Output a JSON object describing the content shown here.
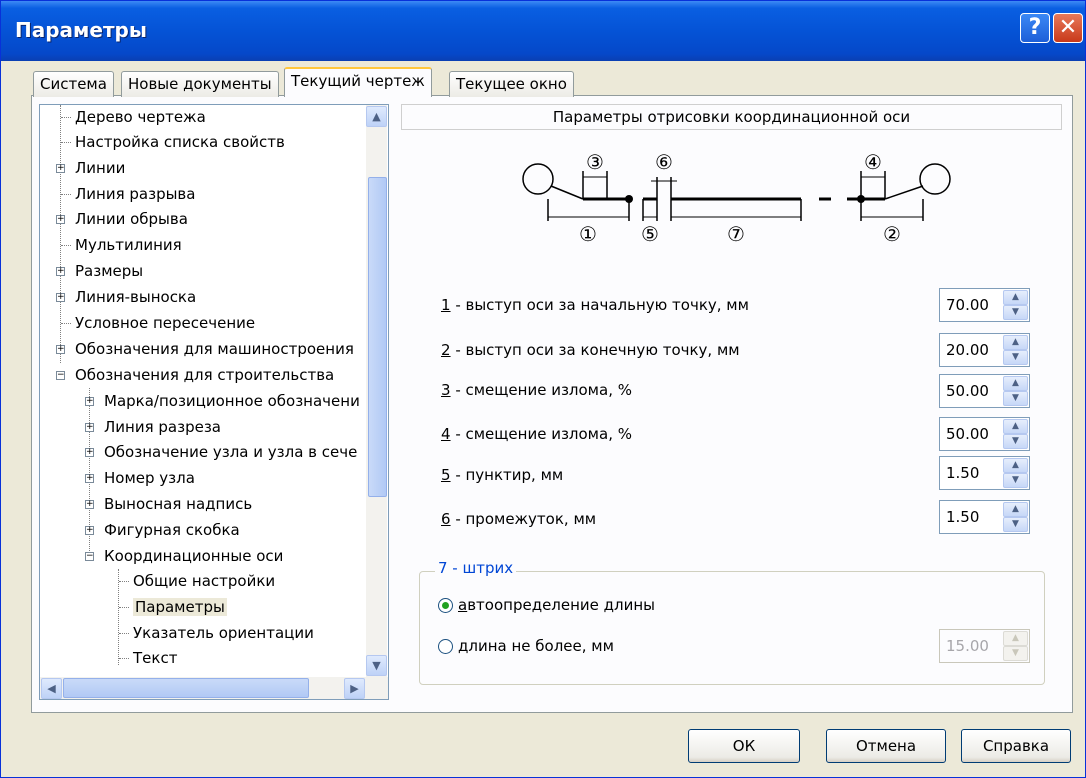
{
  "window": {
    "title": "Параметры"
  },
  "tabs": [
    {
      "label": "Система"
    },
    {
      "label": "Новые документы"
    },
    {
      "label": "Текущий чертеж"
    },
    {
      "label": "Текущее окно"
    }
  ],
  "tree": {
    "items": [
      {
        "label": "Дерево чертежа"
      },
      {
        "label": "Настройка списка свойств"
      },
      {
        "label": "Линии"
      },
      {
        "label": "Линия разрыва"
      },
      {
        "label": "Линии обрыва"
      },
      {
        "label": "Мультилиния"
      },
      {
        "label": "Размеры"
      },
      {
        "label": "Линия-выноска"
      },
      {
        "label": "Условное пересечение"
      },
      {
        "label": "Обозначения для машиностроения"
      },
      {
        "label": "Обозначения для строительства"
      },
      {
        "label": "Марка/позиционное обозначени"
      },
      {
        "label": "Линия разреза"
      },
      {
        "label": "Обозначение узла и узла в сече"
      },
      {
        "label": "Номер узла"
      },
      {
        "label": "Выносная надпись"
      },
      {
        "label": "Фигурная скобка"
      },
      {
        "label": "Координационные оси"
      },
      {
        "label": "Общие настройки"
      },
      {
        "label": "Параметры"
      },
      {
        "label": "Указатель ориентации"
      },
      {
        "label": "Текст"
      }
    ]
  },
  "section": {
    "title": "Параметры отрисовки координационной оси"
  },
  "diagram": {
    "markers": [
      "①",
      "②",
      "③",
      "④",
      "⑤",
      "⑥",
      "⑦"
    ]
  },
  "params": [
    {
      "num": "1",
      "text": " - выступ оси за начальную точку, мм",
      "value": "70.00"
    },
    {
      "num": "2",
      "text": " - выступ оси за конечную точку, мм",
      "value": "20.00"
    },
    {
      "num": "3",
      "text": " - смещение излома, %",
      "value": "50.00"
    },
    {
      "num": "4",
      "text": " - смещение излома, %",
      "value": "50.00"
    },
    {
      "num": "5",
      "text": " - пунктир, мм",
      "value": "1.50"
    },
    {
      "num": "6",
      "text": " - промежуток, мм",
      "value": "1.50"
    }
  ],
  "stroke_group": {
    "legend": "7 - штрих",
    "auto_first": "а",
    "auto_rest": "втоопределение длины",
    "max_first": "д",
    "max_rest": "лина не более, мм",
    "max_value": "15.00",
    "selected": "auto"
  },
  "buttons": {
    "ok": "ОК",
    "cancel": "Отмена",
    "help": "Справка"
  }
}
